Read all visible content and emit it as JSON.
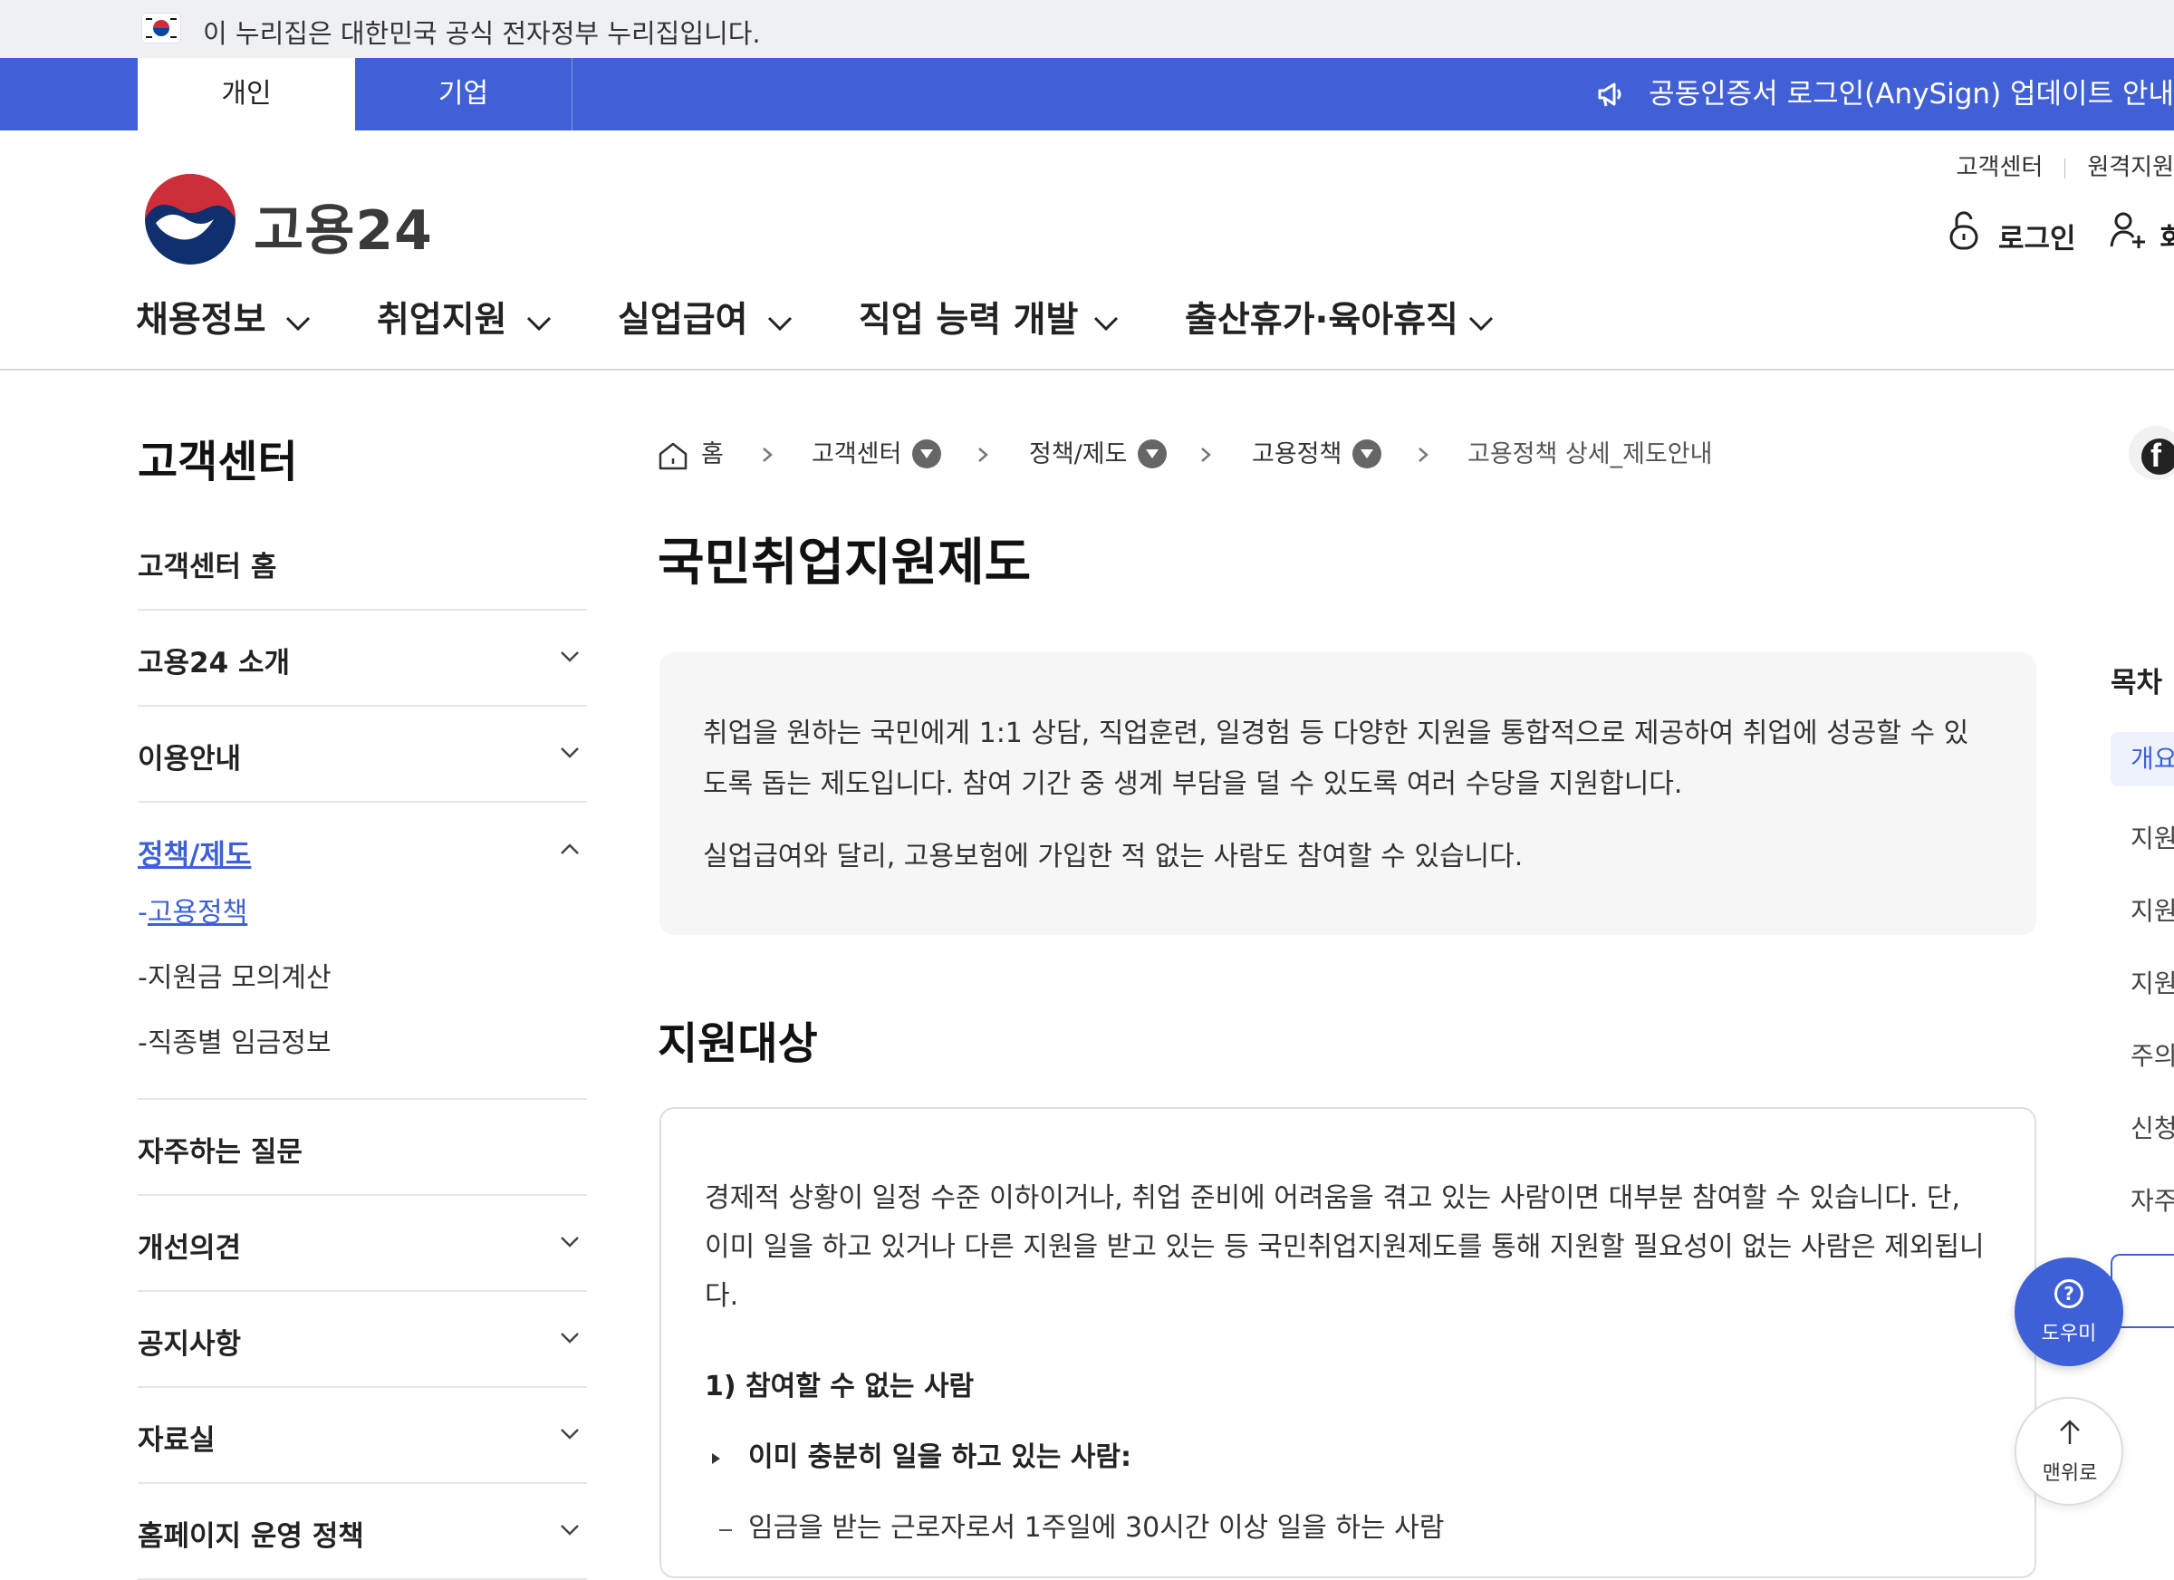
{
  "gov_banner": {
    "text": "이 누리집은 대한민국 공식 전자정부 누리집입니다."
  },
  "top_tabs": [
    {
      "label": "개인"
    },
    {
      "label": "기업"
    }
  ],
  "notice": {
    "text": "공동인증서 로그인(AnySign) 업데이트 안내"
  },
  "header": {
    "logo_text": "고용24",
    "util_links": [
      "고객센터",
      "원격지원"
    ],
    "login_label": "로그인",
    "signup_label": "회원가입"
  },
  "gnb": [
    {
      "label": "채용정보"
    },
    {
      "label": "취업지원"
    },
    {
      "label": "실업급여"
    },
    {
      "label": "직업 능력 개발"
    },
    {
      "label": "출산휴가·육아휴직"
    }
  ],
  "sidebar": {
    "title": "고객센터",
    "items": [
      {
        "label": "고객센터 홈"
      },
      {
        "label": "고용24 소개"
      },
      {
        "label": "이용안내"
      },
      {
        "label": "정책/제도",
        "sub": [
          "고용정책",
          "지원금 모의계산",
          "직종별 임금정보"
        ]
      },
      {
        "label": "자주하는 질문"
      },
      {
        "label": "개선의견"
      },
      {
        "label": "공지사항"
      },
      {
        "label": "자료실"
      },
      {
        "label": "홈페이지 운영 정책"
      }
    ],
    "sub_prefix": "-"
  },
  "breadcrumb": [
    "홈",
    "고객센터",
    "정책/제도",
    "고용정책",
    "고용정책 상세_제도안내"
  ],
  "page": {
    "title": "국민취업지원제도",
    "intro": [
      "취업을 원하는 국민에게 1:1 상담, 직업훈련, 일경험 등 다양한 지원을 통합적으로 제공하여 취업에 성공할 수 있도록 돕는 제도입니다. 참여 기간 중 생계 부담을 덜 수 있도록 여러 수당을 지원합니다.",
      "실업급여와 달리, 고용보험에 가입한 적 없는 사람도 참여할 수 있습니다."
    ],
    "section_title": "지원대상",
    "section_body": "경제적 상황이 일정 수준 이하이거나, 취업 준비에 어려움을 겪고 있는 사람이면 대부분 참여할 수 있습니다. 단, 이미 일을 하고 있거나 다른 지원을 받고 있는 등 국민취업지원제도를 통해 지원할 필요성이 없는 사람은 제외됩니다.",
    "sub_heading": "1) 참여할 수 없는 사람",
    "bullet": "이미 충분히 일을 하고 있는 사람:",
    "dash": "임금을 받는 근로자로서 1주일에 30시간 이상 일을 하는 사람"
  },
  "toc": {
    "title": "목차",
    "items": [
      "개요",
      "지원",
      "지원",
      "지원",
      "주의",
      "신청",
      "자주"
    ]
  },
  "floating": {
    "help_label": "도우미",
    "top_label": "맨위로"
  },
  "colors": {
    "primary": "#4160d6",
    "link": "#3e60d6"
  }
}
